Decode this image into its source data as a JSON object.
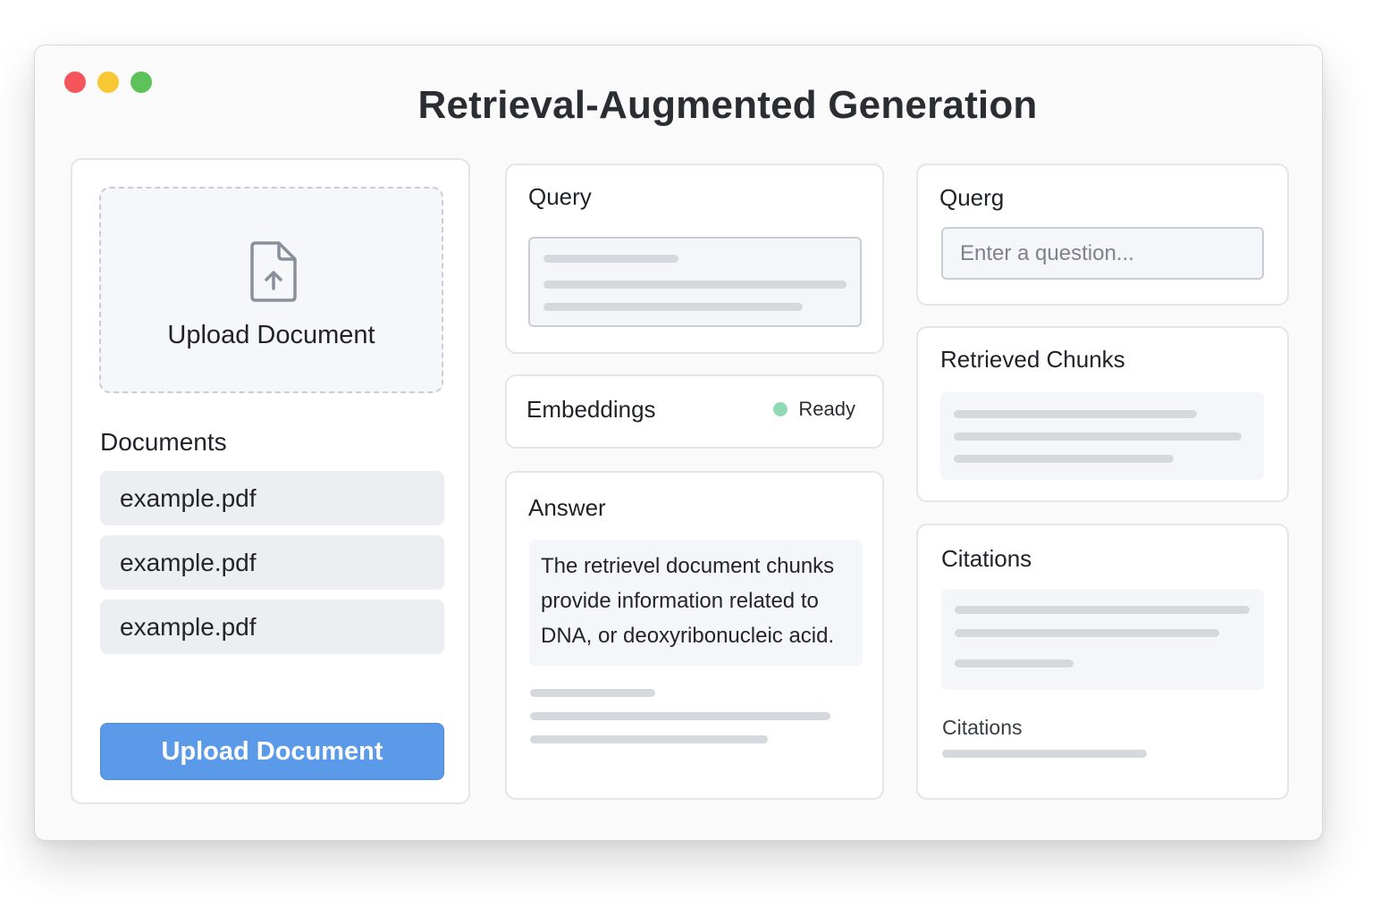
{
  "window": {
    "title": "Retrieval-Augmented Generation",
    "traffic_lights": [
      "close",
      "minimize",
      "zoom"
    ],
    "colors": {
      "close": "#f5555b",
      "minimize": "#f8c834",
      "zoom": "#5ec25a"
    }
  },
  "left_panel": {
    "dropzone": {
      "icon": "file-upload-icon",
      "label": "Upload Document"
    },
    "documents_heading": "Documents",
    "documents": [
      "example.pdf",
      "example.pdf",
      "example.pdf"
    ],
    "upload_button": "Upload Document",
    "accent_color": "#5a9ae9"
  },
  "query_card": {
    "title": "Query"
  },
  "embeddings_card": {
    "title": "Embeddings",
    "status": "Ready",
    "status_color": "#8fdab5"
  },
  "answer_card": {
    "title": "Answer",
    "text": "The retrievel document chunks provide information related to DNA, or deoxyribonucleic acid."
  },
  "question_card": {
    "title": "Querg",
    "placeholder": "Enter a question..."
  },
  "chunks_card": {
    "title": "Retrieved Chunks"
  },
  "citations_card": {
    "title": "Citations",
    "label": "Citations"
  }
}
